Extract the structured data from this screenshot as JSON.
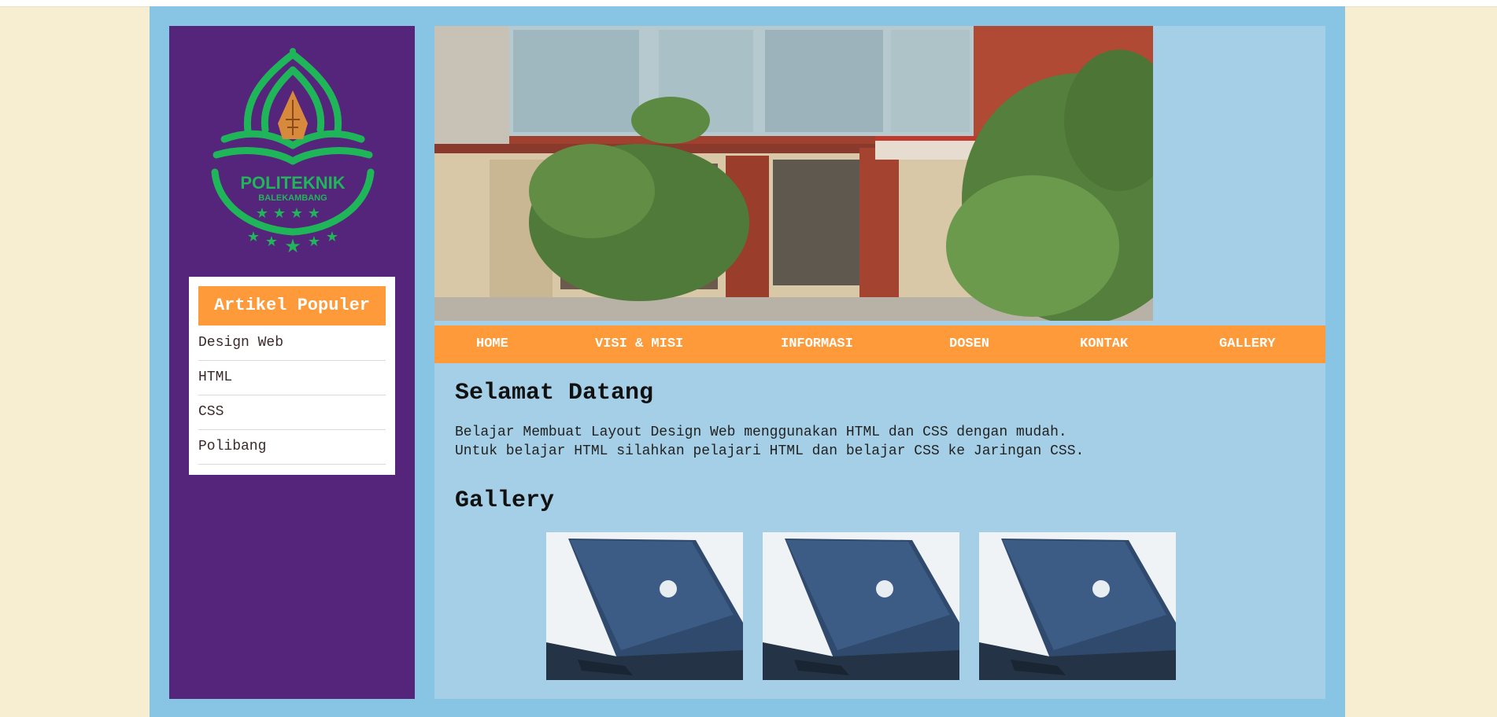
{
  "brand": {
    "logo_text": "POLITEKNIK",
    "logo_subtext": "BALEKAMBANG"
  },
  "colors": {
    "page_bg": "#f7edd0",
    "wrapper_bg": "#88c4e3",
    "content_bg": "#a4cfe6",
    "sidebar_bg": "#55247b",
    "accent": "#ff9a3b",
    "logo_green": "#1fb65a"
  },
  "sidebar": {
    "widget_title": "Artikel Populer",
    "items": [
      {
        "label": "Design Web"
      },
      {
        "label": "HTML"
      },
      {
        "label": "CSS"
      },
      {
        "label": "Polibang"
      }
    ]
  },
  "nav": {
    "items": [
      {
        "label": "HOME"
      },
      {
        "label": "VISI & MISI"
      },
      {
        "label": "INFORMASI"
      },
      {
        "label": "DOSEN"
      },
      {
        "label": "KONTAK"
      },
      {
        "label": "GALLERY"
      }
    ]
  },
  "main": {
    "welcome_title": "Selamat Datang",
    "intro_line1": "Belajar Membuat Layout Design Web menggunakan HTML dan CSS dengan mudah.",
    "intro_line2": "Untuk belajar HTML silahkan pelajari HTML dan belajar CSS ke Jaringan CSS.",
    "gallery_title": "Gallery",
    "gallery_images": [
      {
        "icon": "laptop-image"
      },
      {
        "icon": "laptop-image"
      },
      {
        "icon": "laptop-image"
      }
    ]
  }
}
